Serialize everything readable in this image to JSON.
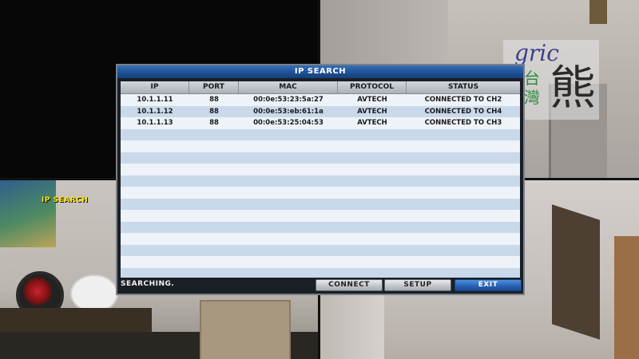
{
  "overlay_label": "IP SEARCH",
  "watermark": {
    "text_latin": "gric",
    "text_cjk_small": "台\n灣",
    "text_cjk_big": "熊"
  },
  "dialog": {
    "title": "IP SEARCH",
    "columns": [
      "IP",
      "PORT",
      "MAC",
      "PROTOCOL",
      "STATUS"
    ],
    "rows": [
      {
        "ip": "10.1.1.11",
        "port": "88",
        "mac": "00:0e:53:23:5a:27",
        "protocol": "AVTECH",
        "status": "CONNECTED TO CH2"
      },
      {
        "ip": "10.1.1.12",
        "port": "88",
        "mac": "00:0e:53:eb:61:1a",
        "protocol": "AVTECH",
        "status": "CONNECTED TO CH4"
      },
      {
        "ip": "10.1.1.13",
        "port": "88",
        "mac": "00:0e:53:25:04:53",
        "protocol": "AVTECH",
        "status": "CONNECTED TO CH3"
      }
    ],
    "empty_row_count": 13,
    "status_text": "SEARCHING.",
    "buttons": {
      "connect": "CONNECT",
      "setup": "SETUP",
      "exit": "EXIT"
    }
  },
  "colors": {
    "title_bar": "#1d4f93",
    "row_alt": "#c9d9ea",
    "exit_button": "#2a63b6",
    "overlay_label": "#ffe800"
  }
}
